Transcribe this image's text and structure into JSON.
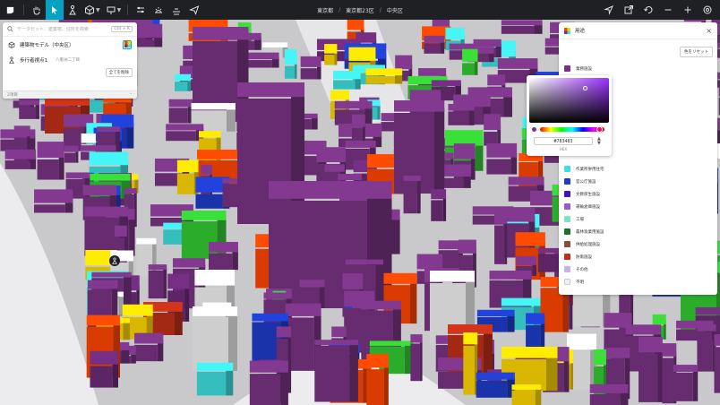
{
  "toolbar": {
    "tools": [
      {
        "icon": "hand-icon"
      },
      {
        "icon": "pointer-icon",
        "active": true
      },
      {
        "icon": "pedestrian-icon"
      },
      {
        "icon": "cube-icon"
      },
      {
        "icon": "sign-icon"
      },
      {
        "icon": "sliders-icon"
      },
      {
        "icon": "sun-icon"
      },
      {
        "icon": "layers-icon"
      },
      {
        "icon": "share-icon"
      }
    ],
    "right_icons": [
      "location-icon",
      "export-icon",
      "undo-icon",
      "zoom-out-icon",
      "zoom-in-icon",
      "settings-icon"
    ]
  },
  "breadcrumbs": [
    "東京都",
    "東京都23区",
    "中央区"
  ],
  "search": {
    "placeholder": "データセット、建築物、住所を検索",
    "shortcut": "Ctrl + K"
  },
  "layers": [
    {
      "label": "建築物モデル（中央区）"
    },
    {
      "label": "歩行者視点1",
      "sublabel": "八重洲二丁目"
    }
  ],
  "delete_all_label": "全てを削除",
  "layer_count_label": "2項目",
  "legend_panel": {
    "title": "用途",
    "reset_label": "色をリセット",
    "items": [
      {
        "label": "業務施設",
        "color": "#783483"
      },
      {
        "label": "",
        "color": "#ff4500"
      },
      {
        "label": "",
        "color": "#ffd700"
      },
      {
        "label": "",
        "color": "#ff8c00"
      },
      {
        "label": "",
        "color": "#00bfff"
      },
      {
        "label": "",
        "color": "#33cc33"
      },
      {
        "label": "",
        "color": "#f4e4a4"
      },
      {
        "label": "作業所併用住宅",
        "color": "#3ee0e0"
      },
      {
        "label": "官公庁施設",
        "color": "#1e3cc8"
      },
      {
        "label": "文教厚生施設",
        "color": "#3c14c8"
      },
      {
        "label": "運輸倉庫施設",
        "color": "#9b59d0"
      },
      {
        "label": "工場",
        "color": "#7de0c8"
      },
      {
        "label": "農林漁業用施設",
        "color": "#1e6e2e"
      },
      {
        "label": "供給処理施設",
        "color": "#8b4a3c"
      },
      {
        "label": "防衛施設",
        "color": "#c03018"
      },
      {
        "label": "その他",
        "color": "#c8b4e0"
      },
      {
        "label": "不明",
        "color": "#eeeeee"
      }
    ]
  },
  "color_picker": {
    "hex_value": "#783483",
    "mode_label": "HEX"
  },
  "colors": {
    "toolbar_bg": "#1f2023",
    "accent": "#00a3c4",
    "map_bg": "#d6d6d8"
  }
}
